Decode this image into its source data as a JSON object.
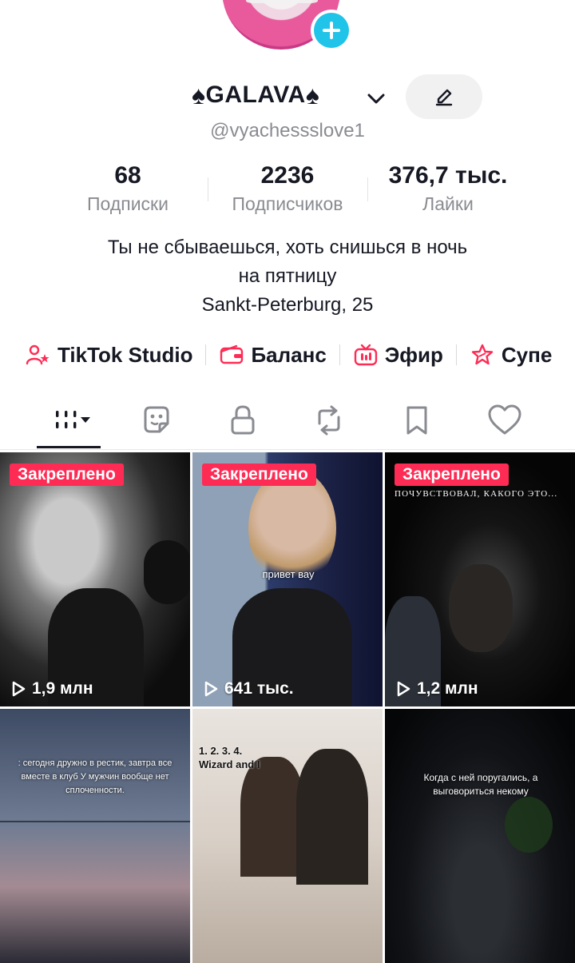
{
  "profile": {
    "display_name": "GALAVA",
    "name_decoration": "♠",
    "handle": "@vyachessslove1",
    "bio_lines": [
      "Ты не сбываешься, хоть снишься в ночь",
      "на пятницу",
      "Sankt-Peterburg, 25"
    ]
  },
  "stats": [
    {
      "value": "68",
      "label": "Подписки"
    },
    {
      "value": "2236",
      "label": "Подписчиков"
    },
    {
      "value": "376,7 тыс.",
      "label": "Лайки"
    }
  ],
  "links": [
    {
      "label": "TikTok Studio",
      "icon": "person-star-icon"
    },
    {
      "label": "Баланс",
      "icon": "wallet-icon"
    },
    {
      "label": "Эфир",
      "icon": "live-tv-icon"
    },
    {
      "label": "Супе",
      "icon": "super-star-icon"
    }
  ],
  "tabs": [
    {
      "name": "videos",
      "icon": "grid-icon",
      "active": true
    },
    {
      "name": "stickers",
      "icon": "sticker-icon"
    },
    {
      "name": "private",
      "icon": "lock-icon"
    },
    {
      "name": "reposts",
      "icon": "repost-icon"
    },
    {
      "name": "favorites",
      "icon": "bookmark-icon"
    },
    {
      "name": "liked",
      "icon": "heart-icon"
    }
  ],
  "videos": [
    {
      "pinned": true,
      "pin_label": "Закреплено",
      "views": "1,9 млн",
      "caption": ""
    },
    {
      "pinned": true,
      "pin_label": "Закреплено",
      "views": "641 тыс.",
      "caption": "привет вау"
    },
    {
      "pinned": true,
      "pin_label": "Закреплено",
      "views": "1,2 млн",
      "caption": "ПОЧУВСТВОВАЛ, КАКОГО ЭТО..."
    },
    {
      "pinned": false,
      "views": "",
      "caption": ": сегодня дружно в рестик, завтра все вместе в клуб У мужчин вообще нет сплоченности."
    },
    {
      "pinned": false,
      "views": "",
      "caption": "1. 2. 3. 4. Wizard and I"
    },
    {
      "pinned": false,
      "views": "",
      "caption": "Когда с ней поругались, а выговориться некому"
    }
  ],
  "colors": {
    "accent": "#fe2c55",
    "avatar_add": "#20c4e8",
    "muted": "#8a8b91"
  }
}
